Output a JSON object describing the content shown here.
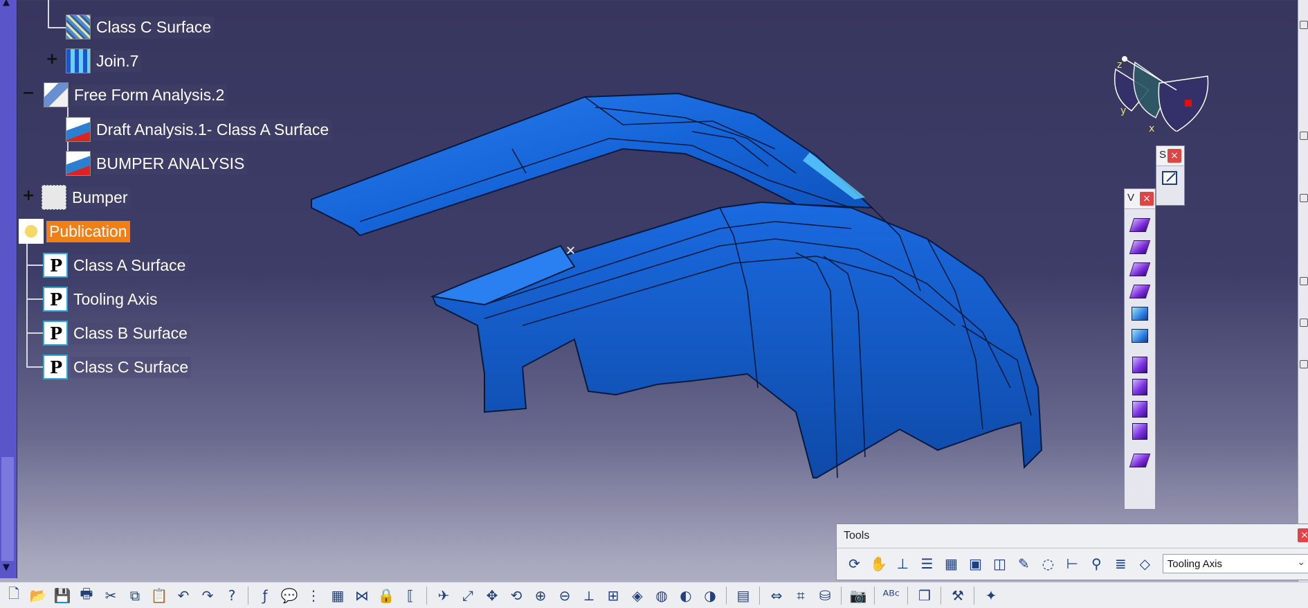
{
  "tree": {
    "items": [
      {
        "label": "Class C Surface",
        "icon": "surface-icon"
      },
      {
        "label": "Join.7",
        "icon": "join-icon"
      },
      {
        "label": "Free Form Analysis.2",
        "icon": "freeform-analysis-icon"
      },
      {
        "label": "Draft Analysis.1- Class A Surface",
        "icon": "draft-analysis-icon"
      },
      {
        "label": "BUMPER ANALYSIS",
        "icon": "draft-analysis-icon"
      },
      {
        "label": "Bumper",
        "icon": "document-icon"
      },
      {
        "label": "Publication",
        "icon": "publication-gear-icon",
        "selected": true
      },
      {
        "label": "Class A Surface",
        "icon": "publication-icon"
      },
      {
        "label": "Tooling Axis",
        "icon": "publication-icon"
      },
      {
        "label": "Class B Surface",
        "icon": "publication-icon"
      },
      {
        "label": "Class C Surface",
        "icon": "publication-icon"
      }
    ]
  },
  "compass": {
    "x": "x",
    "y": "y",
    "z": "z"
  },
  "small_toolbar": {
    "title": "S",
    "close": "×"
  },
  "vertical_toolbar": {
    "title": "V",
    "close": "×"
  },
  "tools_toolbar": {
    "title": "Tools",
    "close": "×",
    "selected_axis": "Tooling Axis"
  },
  "colors": {
    "model": "#1565d8",
    "selection": "#f07f16",
    "bg_top": "#37365f",
    "bg_bottom": "#b8b8c8"
  }
}
